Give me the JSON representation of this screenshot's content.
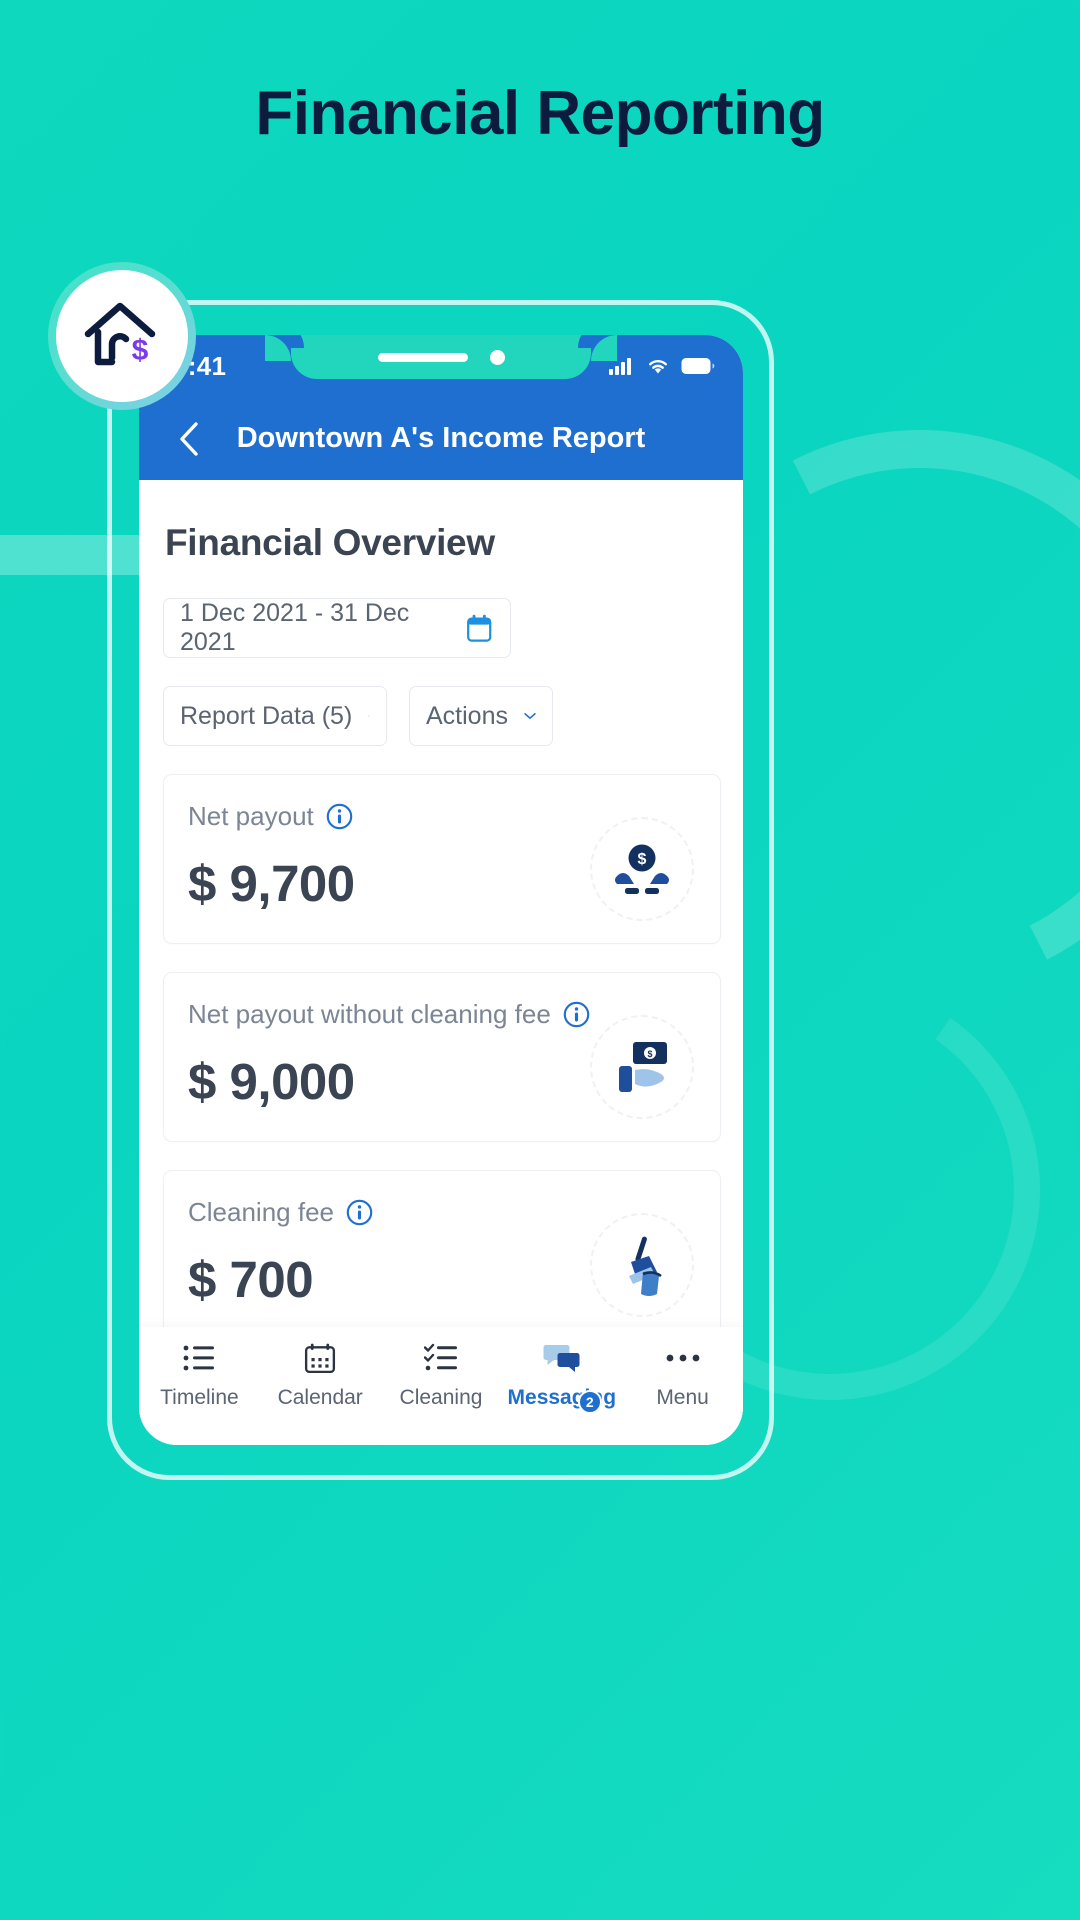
{
  "page": {
    "title": "Financial Reporting",
    "title_color": "#0d1b3e",
    "background_color": "#0ed8bd"
  },
  "logo": {
    "house_icon": "house-icon",
    "dollar_glyph": "$",
    "dollar_color": "#7c3aed",
    "house_color": "#0d1b3e"
  },
  "phone": {
    "status_bar": {
      "time": "9:41",
      "icons": [
        "signal-icon",
        "wifi-icon",
        "battery-icon"
      ]
    },
    "header": {
      "back_icon": "chevron-left-icon",
      "title": "Downtown A's Income Report",
      "background_color": "#1f6fd0"
    }
  },
  "main": {
    "section_title": "Financial Overview",
    "date_range": {
      "value": "1 Dec 2021 - 31 Dec 2021",
      "icon": "calendar-icon",
      "icon_color": "#1f6fd0"
    },
    "dropdowns": [
      {
        "label": "Report Data (5)",
        "icon": "chevron-down-icon"
      },
      {
        "label": "Actions",
        "icon": "chevron-down-icon"
      }
    ],
    "cards": [
      {
        "label": "Net payout",
        "info_icon": "info-icon",
        "value": "$ 9,700",
        "illustration": "hands-holding-coin-icon"
      },
      {
        "label": "Net payout without cleaning fee",
        "info_icon": "info-icon",
        "value": "$ 9,000",
        "illustration": "hand-holding-money-icon"
      },
      {
        "label": "Cleaning fee",
        "info_icon": "info-icon",
        "value": "$ 700",
        "illustration": "broom-bucket-icon"
      }
    ]
  },
  "bottom_nav": {
    "items": [
      {
        "label": "Timeline",
        "icon": "list-icon",
        "active": false,
        "badge": ""
      },
      {
        "label": "Calendar",
        "icon": "calendar-icon",
        "active": false,
        "badge": ""
      },
      {
        "label": "Cleaning",
        "icon": "checklist-icon",
        "active": false,
        "badge": ""
      },
      {
        "label": "Messaging",
        "icon": "chat-icon",
        "active": true,
        "badge": "2"
      },
      {
        "label": "Menu",
        "icon": "ellipsis-icon",
        "active": false,
        "badge": ""
      }
    ],
    "active_color": "#1f6fd0"
  }
}
